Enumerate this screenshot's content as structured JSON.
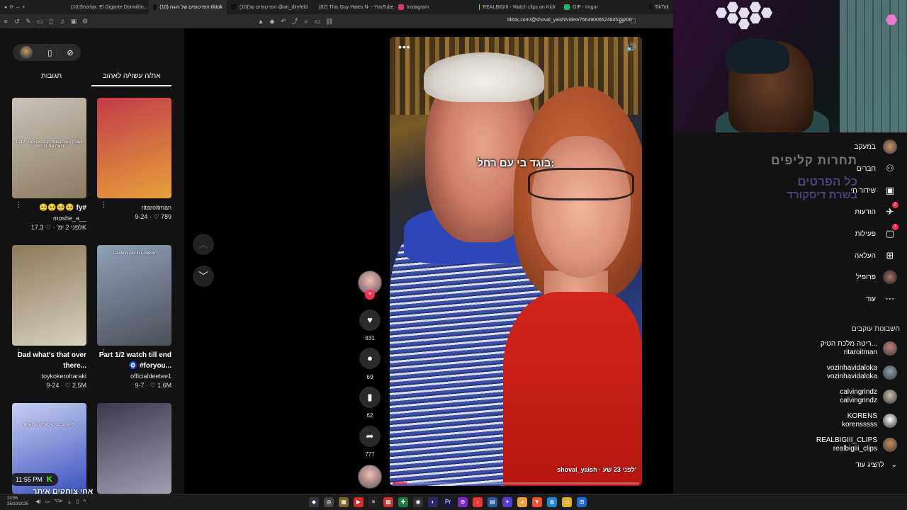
{
  "browser": {
    "tabs": [
      {
        "label": "(10)Snorlax: El Gigante Dormilón...",
        "color": "#ff3d3d",
        "active": false
      },
      {
        "label": "הפרטופים של הוגה (10) tiktok",
        "color": "#111111",
        "active": true
      },
      {
        "label": "(10)הפרטופים של @ari_dimfeld",
        "color": "#111111",
        "active": false
      },
      {
        "label": "(82) This Guy Hates N- - YouTube",
        "color": "#ff0000",
        "active": false
      },
      {
        "label": "Instagram",
        "color": "#e1306c",
        "active": false
      },
      {
        "label": "REALBIGIII - Watch clips on Kick",
        "color": "#53fc18",
        "active": false
      },
      {
        "label": "GIF - Imgur",
        "color": "#1bb76e",
        "active": false
      },
      {
        "label": "TikTok",
        "color": "#111111",
        "active": false
      }
    ],
    "url": "tiktok.com/@shoval_yaish/video/7564900662484520200"
  },
  "left": {
    "tabs": [
      "תגובות",
      "את/ה עשוי/ה לאהוב"
    ],
    "active_tab": 1,
    "cards": [
      {
        "title": "🥺🥺🥺🥺 fy#",
        "user": "moshe_a__",
        "views": "17.3K",
        "date": "לפני 2 ימ'",
        "overlay": "POV: גאולה עובר במסדרון בבית ספר ורואה את בן כיתה",
        "colors": [
          "#c9c4b8",
          "#8a7a62"
        ]
      },
      {
        "title": "",
        "user": "ritaroitman",
        "views": "789",
        "date": "9-24",
        "overlay": "",
        "colors": [
          "#c23a4a",
          "#e6a23a"
        ]
      },
      {
        "title": "Dad what's that over there...",
        "user": "toykokeroharaki",
        "views": "2.5M",
        "date": "9-24",
        "overlay": "",
        "colors": [
          "#8a7a58",
          "#d9d2c0"
        ]
      },
      {
        "title": "Part 1/2 watch till end 🧿 #foryou...",
        "user": "officialdeetee1",
        "views": "1.6M",
        "date": "9-7",
        "overlay": "Casting call in London",
        "colors": [
          "#8fa0b6",
          "#4a5058"
        ]
      },
      {
        "title": "",
        "user": "",
        "views": "",
        "date": "",
        "overlay": "חיקוי עם ציקו מוסיקו קרואסון",
        "colors": [
          "#c8d0f0",
          "#3a50c0"
        ]
      },
      {
        "title": "",
        "user": "",
        "views": "",
        "date": "",
        "overlay": "",
        "colors": [
          "#3a3a4a",
          "#a0a0b0"
        ]
      }
    ]
  },
  "video": {
    "caption": "בוגד בי עם רחל:",
    "author": "shoval_yaish",
    "time": "לפני 23 שע'",
    "progress": 0.06
  },
  "actions": {
    "likes": "831",
    "comments": "69",
    "saves": "62",
    "shares": "777"
  },
  "right": {
    "nav": [
      {
        "label": "במעקב",
        "icon": "avatar-icon",
        "glyph": "◉"
      },
      {
        "label": "חברים",
        "icon": "friends-icon",
        "glyph": "👥"
      },
      {
        "label": "שידור חי",
        "icon": "live-icon",
        "glyph": "📺"
      },
      {
        "label": "הודעות",
        "icon": "messages-icon",
        "glyph": "✈",
        "badge": "2"
      },
      {
        "label": "פעילות",
        "icon": "activity-icon",
        "glyph": "💬",
        "badge": "1"
      },
      {
        "label": "העלאה",
        "icon": "upload-icon",
        "glyph": "⊞"
      },
      {
        "label": "פרופיל",
        "icon": "profile-icon",
        "glyph": "●"
      },
      {
        "label": "עוד",
        "icon": "more-icon",
        "glyph": "⋯"
      }
    ],
    "promo": {
      "line1": "תחרות קליפים",
      "line2": "כל הפרטים",
      "line3": "בשרת דיסקורד"
    },
    "following_title": "חשבונות עוקבים",
    "accounts": [
      {
        "name": "ריטה מלכת הטיק...",
        "handle": "ritaroitman",
        "color": "#c08070"
      },
      {
        "name": "vozinhavidaloka",
        "handle": "vozinhavidaloka",
        "color": "#8aa0b0"
      },
      {
        "name": "calvingrindz",
        "handle": "calvingrindz",
        "color": "#d0c0b0"
      },
      {
        "name": "KORENS",
        "handle": "korensssss",
        "color": "#ffffff"
      },
      {
        "name": "REALBIGIII_CLIPS",
        "handle": "realbigiii_clips",
        "color": "#d08a50"
      }
    ],
    "show_more": "להציג עוד"
  },
  "stream_overlay": {
    "time": "11:55 PM",
    "caption": "אחי צוחקים איתך"
  },
  "taskbar": {
    "time": "23:55",
    "date": "25/10/2025",
    "lang": "עבר"
  }
}
